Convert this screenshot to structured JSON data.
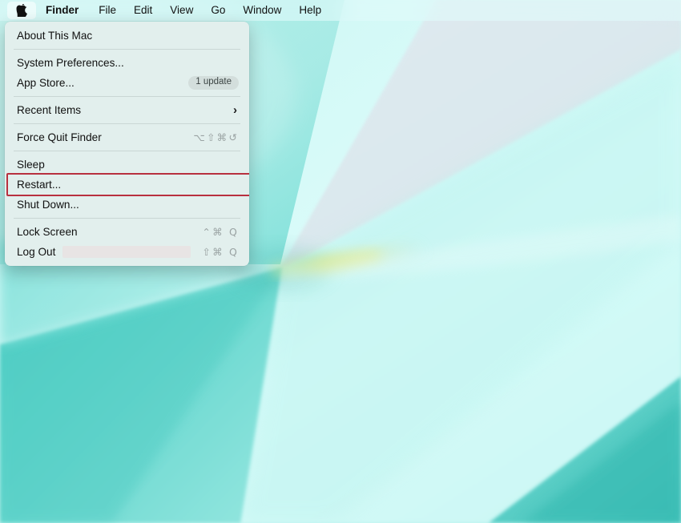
{
  "menubar": {
    "apple_icon": "apple-logo-icon",
    "items": [
      {
        "label": "Finder",
        "bold": true
      },
      {
        "label": "File",
        "bold": false
      },
      {
        "label": "Edit",
        "bold": false
      },
      {
        "label": "View",
        "bold": false
      },
      {
        "label": "Go",
        "bold": false
      },
      {
        "label": "Window",
        "bold": false
      },
      {
        "label": "Help",
        "bold": false
      }
    ]
  },
  "apple_menu": {
    "about": {
      "label": "About This Mac"
    },
    "system_preferences": {
      "label": "System Preferences..."
    },
    "app_store": {
      "label": "App Store...",
      "badge": "1 update"
    },
    "recent_items": {
      "label": "Recent Items",
      "chevron": "›"
    },
    "force_quit": {
      "label": "Force Quit Finder",
      "shortcut": "⌥⇧⌘↺"
    },
    "sleep": {
      "label": "Sleep"
    },
    "restart": {
      "label": "Restart..."
    },
    "shut_down": {
      "label": "Shut Down..."
    },
    "lock_screen": {
      "label": "Lock Screen",
      "shortcut": "⌃⌘ Q"
    },
    "log_out": {
      "label": "Log Out",
      "shortcut": "⇧⌘ Q"
    }
  },
  "annotation": {
    "target": "Restart...",
    "border_color": "#b8303f"
  },
  "colors": {
    "menu_background": "#e2efed",
    "menubar_background": "#e1fafa",
    "wallpaper_teal": "#7fe0dc",
    "wallpaper_pale": "#dce9ee",
    "wallpaper_light": "#d8fbfa",
    "badge_background": "#d3dedc",
    "shortcut_text": "#9aa3a3"
  }
}
